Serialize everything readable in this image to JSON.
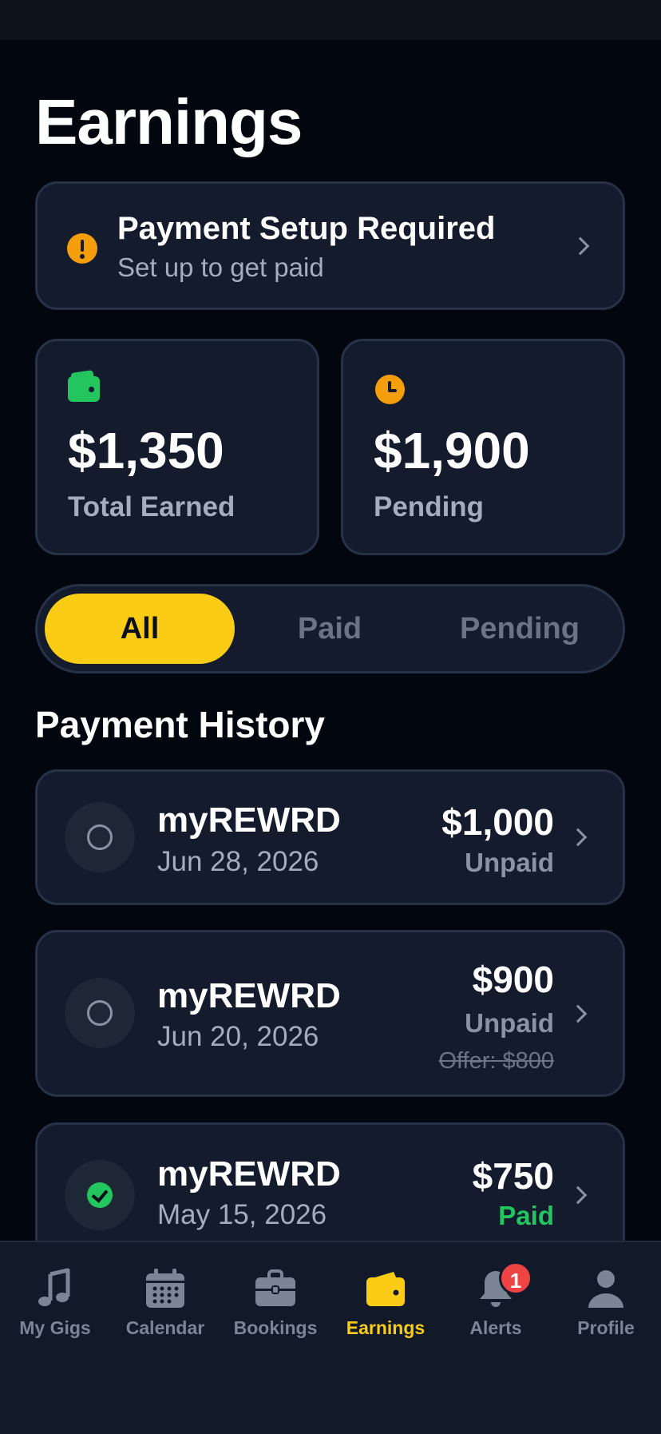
{
  "page": {
    "title": "Earnings"
  },
  "setup_banner": {
    "title": "Payment Setup Required",
    "subtitle": "Set up to get paid",
    "icon": "alert-icon"
  },
  "stats": [
    {
      "value": "$1,350",
      "label": "Total Earned",
      "icon": "wallet-icon",
      "icon_color": "#22c55e"
    },
    {
      "value": "$1,900",
      "label": "Pending",
      "icon": "clock-icon",
      "icon_color": "#f59e0b"
    }
  ],
  "filters": {
    "tabs": [
      "All",
      "Paid",
      "Pending"
    ],
    "selected": "All",
    "accent": "#facc15"
  },
  "history": {
    "title": "Payment History",
    "items": [
      {
        "name": "myREWRD",
        "date": "Jun 28, 2026",
        "amount": "$1,000",
        "status": "Unpaid",
        "offer": ""
      },
      {
        "name": "myREWRD",
        "date": "Jun 20, 2026",
        "amount": "$900",
        "status": "Unpaid",
        "offer": "Offer: $800"
      },
      {
        "name": "myREWRD",
        "date": "May 15, 2026",
        "amount": "$750",
        "status": "Paid",
        "offer": ""
      }
    ]
  },
  "tab_bar": {
    "items": [
      {
        "label": "My Gigs",
        "icon": "music-note-icon"
      },
      {
        "label": "Calendar",
        "icon": "calendar-icon"
      },
      {
        "label": "Bookings",
        "icon": "briefcase-icon"
      },
      {
        "label": "Earnings",
        "icon": "wallet-icon"
      },
      {
        "label": "Alerts",
        "icon": "bell-icon"
      },
      {
        "label": "Profile",
        "icon": "person-icon"
      }
    ],
    "active": "Earnings",
    "alerts_badge": "1"
  }
}
